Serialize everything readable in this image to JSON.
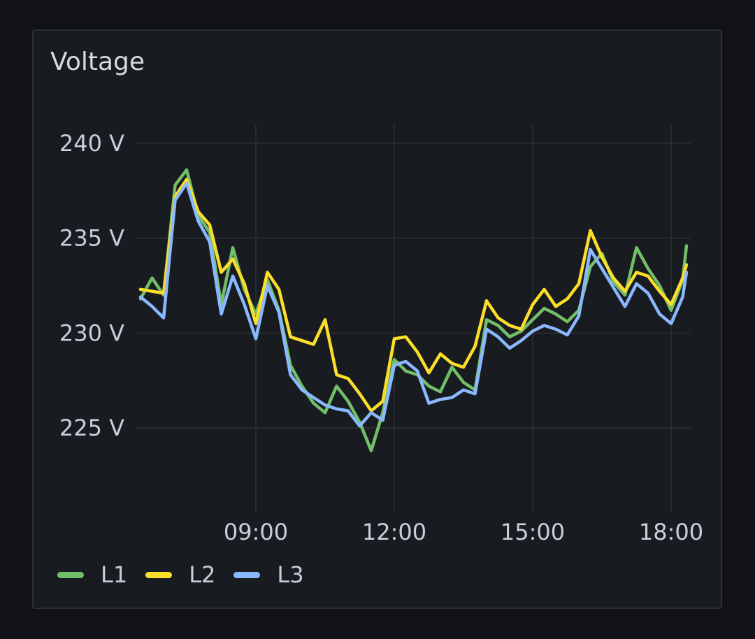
{
  "panel": {
    "title": "Voltage"
  },
  "legend": [
    {
      "label": "L1",
      "color": "#73bf69"
    },
    {
      "label": "L2",
      "color": "#fade2a"
    },
    {
      "label": "L3",
      "color": "#8ab8ff"
    }
  ],
  "chart_data": {
    "type": "line",
    "title": "Voltage",
    "xlabel": "",
    "ylabel": "",
    "unit": "V",
    "x_ticks": [
      "09:00",
      "12:00",
      "15:00",
      "18:00"
    ],
    "y_ticks": [
      "225 V",
      "230 V",
      "235 V",
      "240 V"
    ],
    "xlim": [
      "06:25",
      "18:40"
    ],
    "ylim": [
      221,
      241
    ],
    "grid": true,
    "legend_position": "bottom-left",
    "x": [
      "06:30",
      "06:45",
      "07:00",
      "07:15",
      "07:30",
      "07:45",
      "08:00",
      "08:15",
      "08:30",
      "08:45",
      "09:00",
      "09:15",
      "09:30",
      "09:45",
      "10:00",
      "10:15",
      "10:30",
      "10:45",
      "11:00",
      "11:15",
      "11:30",
      "11:45",
      "12:00",
      "12:15",
      "12:30",
      "12:45",
      "13:00",
      "13:15",
      "13:30",
      "13:45",
      "14:00",
      "14:15",
      "14:30",
      "14:45",
      "15:00",
      "15:15",
      "15:30",
      "15:45",
      "16:00",
      "16:15",
      "16:30",
      "16:45",
      "17:00",
      "17:15",
      "17:30",
      "17:45",
      "18:00",
      "18:15",
      "18:20"
    ],
    "series": [
      {
        "name": "L1",
        "color": "#73bf69",
        "values": [
          231.8,
          232.9,
          232.0,
          237.8,
          238.6,
          236.2,
          235.3,
          231.5,
          234.5,
          232.3,
          231.0,
          232.8,
          231.2,
          228.3,
          227.2,
          226.3,
          225.8,
          227.2,
          226.4,
          225.3,
          223.8,
          225.8,
          228.6,
          228.0,
          227.8,
          227.2,
          226.9,
          228.2,
          227.4,
          227.0,
          230.7,
          230.4,
          229.8,
          230.1,
          230.7,
          231.3,
          231.0,
          230.6,
          231.2,
          233.5,
          234.2,
          232.7,
          232.0,
          234.5,
          233.4,
          232.5,
          231.2,
          232.8,
          234.6
        ]
      },
      {
        "name": "L2",
        "color": "#fade2a",
        "values": [
          232.3,
          232.2,
          232.1,
          237.2,
          238.1,
          236.4,
          235.7,
          233.2,
          233.9,
          232.6,
          230.5,
          233.2,
          232.3,
          229.8,
          229.6,
          229.4,
          230.7,
          227.8,
          227.6,
          226.8,
          225.9,
          226.4,
          229.7,
          229.8,
          229.0,
          227.9,
          228.9,
          228.4,
          228.2,
          229.3,
          231.7,
          230.8,
          230.4,
          230.2,
          231.5,
          232.3,
          231.4,
          231.8,
          232.6,
          235.4,
          234.0,
          232.9,
          232.2,
          233.2,
          233.0,
          232.2,
          231.5,
          232.9,
          233.6
        ]
      },
      {
        "name": "L3",
        "color": "#8ab8ff",
        "values": [
          231.9,
          231.4,
          230.8,
          237.0,
          237.9,
          235.9,
          234.8,
          231.0,
          233.0,
          231.5,
          229.7,
          232.5,
          231.1,
          227.8,
          227.0,
          226.6,
          226.2,
          226.0,
          225.9,
          225.1,
          225.8,
          225.4,
          228.3,
          228.5,
          228.0,
          226.3,
          226.5,
          226.6,
          227.0,
          226.8,
          230.2,
          229.8,
          229.2,
          229.6,
          230.1,
          230.4,
          230.2,
          229.9,
          230.9,
          234.4,
          233.4,
          232.4,
          231.4,
          232.6,
          232.1,
          231.0,
          230.5,
          231.9,
          233.2
        ]
      }
    ]
  }
}
